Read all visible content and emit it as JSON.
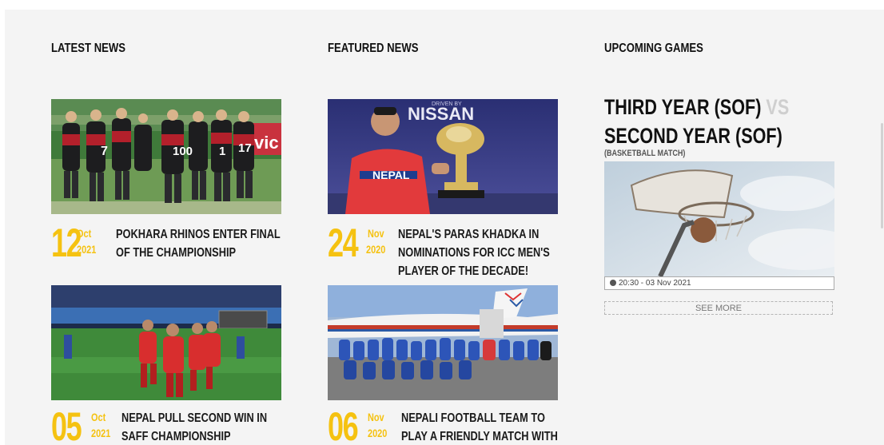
{
  "sections": {
    "latest_title": "LATEST NEWS",
    "featured_title": "FEATURED NEWS",
    "upcoming_title": "UPCOMING GAMES"
  },
  "latest_news": [
    {
      "day": "12",
      "month": "Oct",
      "year": "2021",
      "line1": "POKHARA RHINOS ENTER FINAL",
      "line2": "OF THE CHAMPIONSHIP",
      "line3": ""
    },
    {
      "day": "05",
      "month": "Oct",
      "year": "2021",
      "line1": "NEPAL PULL SECOND WIN IN",
      "line2": "SAFF CHAMPIONSHIP",
      "line3": ""
    }
  ],
  "featured_news": [
    {
      "day": "24",
      "month": "Nov",
      "year": "2020",
      "line1": "NEPAL'S PARAS KHADKA IN",
      "line2": "NOMINATIONS FOR ICC MEN'S",
      "line3": "PLAYER OF THE DECADE!"
    },
    {
      "day": "06",
      "month": "Nov",
      "year": "2020",
      "line1": "NEPALI FOOTBALL TEAM TO",
      "line2": "PLAY A FRIENDLY MATCH WITH",
      "line3": ""
    }
  ],
  "upcoming_game": {
    "team1": "THIRD YEAR (SOF)",
    "vs": "VS",
    "team2": "SECOND YEAR (SOF)",
    "type": "(BASKETBALL MATCH)",
    "time": "20:30 - 03 Nov 2021",
    "see_more": "SEE MORE"
  },
  "image_text": {
    "sponsor_small": "DRIVEN BY",
    "sponsor": "NISSAN",
    "jersey": "NEPAL",
    "ad_text": "vic",
    "jersey_numbers": [
      "7",
      "100",
      "1",
      "17"
    ]
  },
  "colors": {
    "accent": "#f5c211",
    "background": "#f4f4f4",
    "heading": "#111111"
  }
}
